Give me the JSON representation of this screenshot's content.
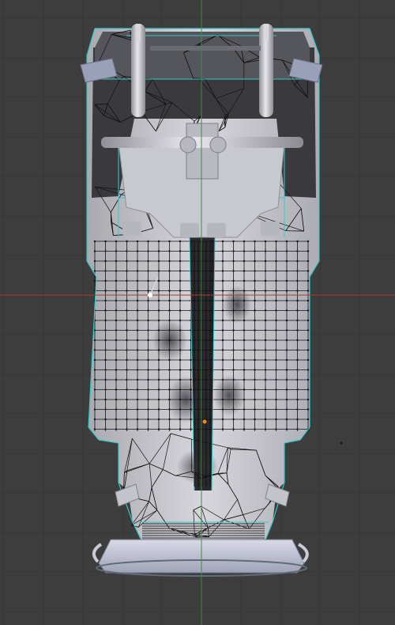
{
  "viewport": {
    "background": "#3d3d3d",
    "grid_color": "#363636",
    "x_axis_color": "#a83a3a",
    "y_axis_color": "#3f8f3f",
    "mesh_face_color": "#c2c2c8",
    "wire_color": "#121212",
    "edge_highlight_color": "#35c9c9",
    "selected_vertex_color": "#ffffff",
    "origin_color": "#f08a1a"
  }
}
